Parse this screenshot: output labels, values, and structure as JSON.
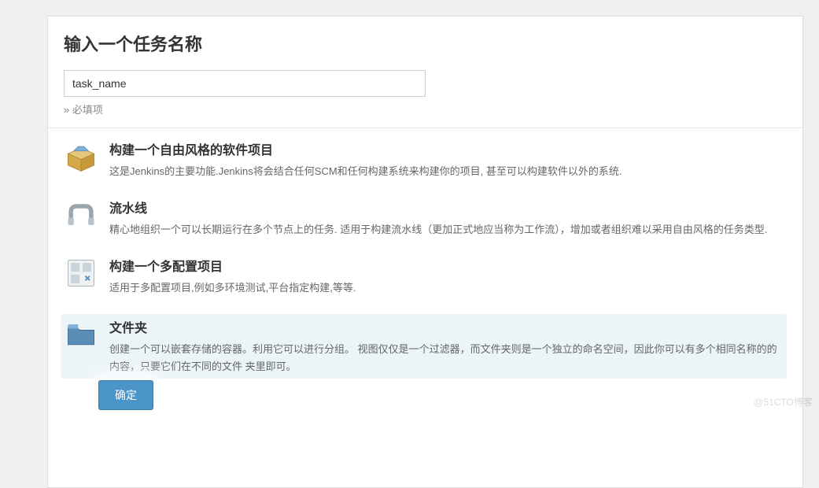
{
  "header": {
    "title": "输入一个任务名称",
    "name_value": "task_name",
    "required_label": "» 必填项"
  },
  "items": [
    {
      "title": "构建一个自由风格的软件项目",
      "desc": "这是Jenkins的主要功能.Jenkins将会结合任何SCM和任何构建系统来构建你的项目, 甚至可以构建软件以外的系统."
    },
    {
      "title": "流水线",
      "desc": "精心地组织一个可以长期运行在多个节点上的任务. 适用于构建流水线（更加正式地应当称为工作流），增加或者组织难以采用自由风格的任务类型."
    },
    {
      "title": "构建一个多配置项目",
      "desc": "适用于多配置项目,例如多环境测试,平台指定构建,等等."
    },
    {
      "title": "文件夹",
      "desc": "创建一个可以嵌套存储的容器。利用它可以进行分组。 视图仅仅是一个过滤器，而文件夹则是一个独立的命名空间，因此你可以有多个相同名称的的内容，只要它们在不同的文件 夹里即可。"
    }
  ],
  "buttons": {
    "ok": "确定"
  },
  "watermark": "@51CTO博客"
}
